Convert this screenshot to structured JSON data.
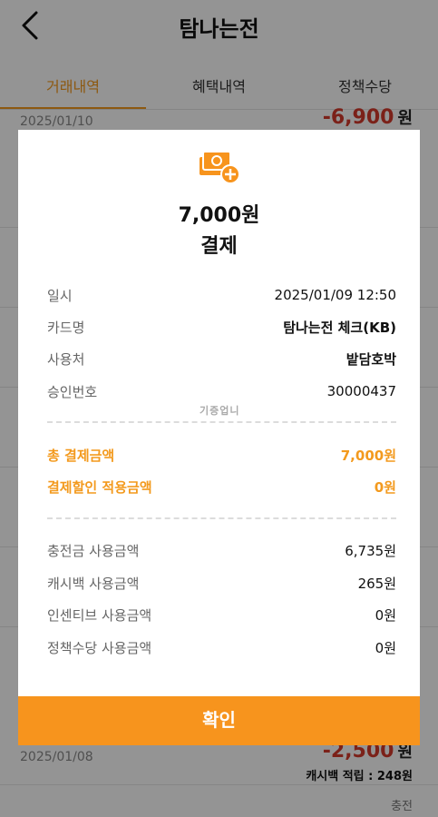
{
  "header": {
    "title": "탐나는전"
  },
  "tabs": [
    {
      "label": "거래내역",
      "active": true
    },
    {
      "label": "혜택내역",
      "active": false
    },
    {
      "label": "정책수당",
      "active": false
    }
  ],
  "background_list": [
    {
      "date": "2025/01/10",
      "amount": "-6,900",
      "won": "원"
    },
    {
      "date": "2025/01/08",
      "amount": "-2,500",
      "won": "원",
      "cashback": "캐시백 적립 : 248원",
      "type": "충전"
    }
  ],
  "modal": {
    "icon": "money-plus-icon",
    "amount": "7,000원",
    "type": "결제",
    "details": [
      {
        "label": "일시",
        "value": "2025/01/09 12:50"
      },
      {
        "label": "카드명",
        "value": "탐나는전 체크(KB)"
      },
      {
        "label": "사용처",
        "value": "밭담호박"
      },
      {
        "label": "승인번호",
        "value": "30000437"
      }
    ],
    "watermark": "기증업니",
    "totals": [
      {
        "label": "총 결제금액",
        "value": "7,000원"
      },
      {
        "label": "결제할인 적용금액",
        "value": "0원"
      }
    ],
    "breakdown": [
      {
        "label": "충전금 사용금액",
        "value": "6,735원"
      },
      {
        "label": "캐시백 사용금액",
        "value": "265원"
      },
      {
        "label": "인센티브 사용금액",
        "value": "0원"
      },
      {
        "label": "정책수당 사용금액",
        "value": "0원"
      }
    ],
    "confirm_label": "확인"
  },
  "colors": {
    "accent": "#f7941d",
    "negative": "#d43a2b"
  }
}
